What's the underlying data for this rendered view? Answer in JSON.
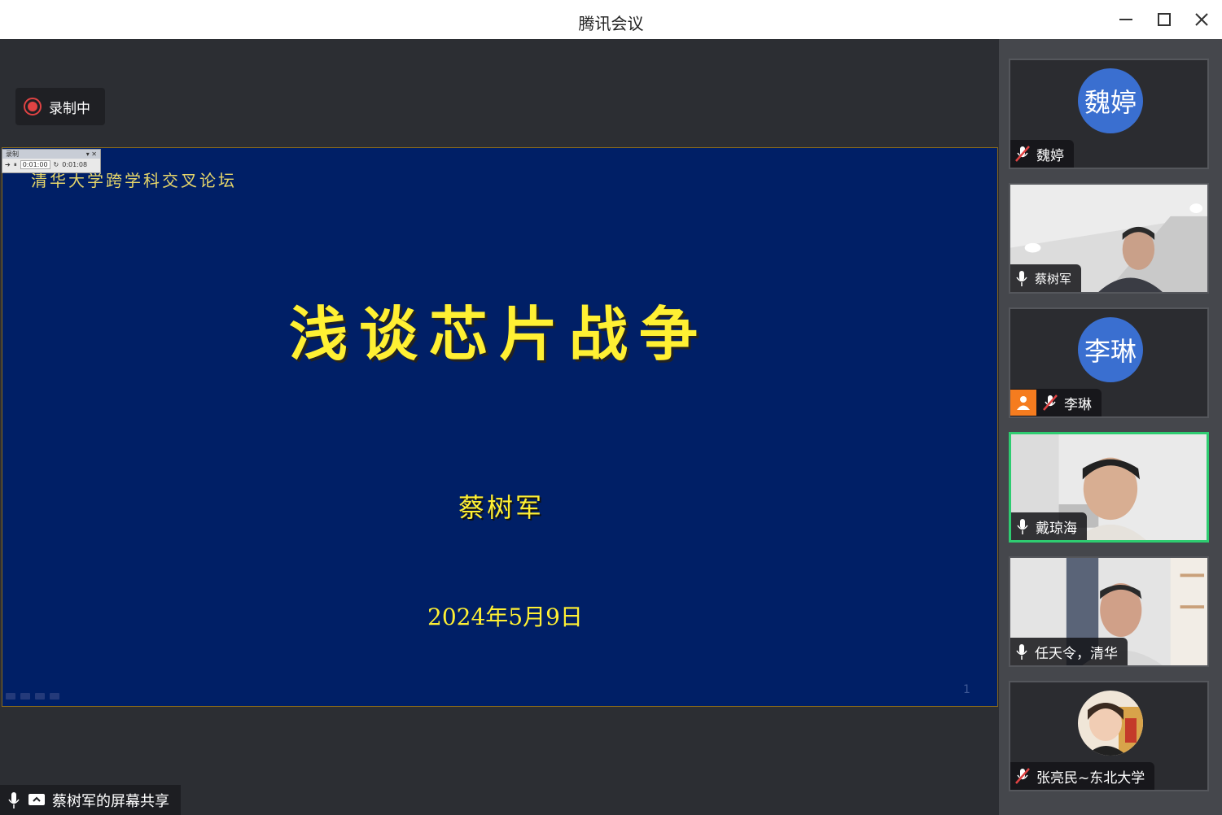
{
  "window": {
    "title": "腾讯会议"
  },
  "recording": {
    "label": "录制中"
  },
  "ppt_toolbar": {
    "title": "录制",
    "elapsed": "0:01:00",
    "total": "0:01:08"
  },
  "slide": {
    "forum": "清华大学跨学科交叉论坛",
    "title": "浅谈芯片战争",
    "speaker": "蔡树军",
    "date": "2024年5月9日",
    "page": "1"
  },
  "share": {
    "label": "蔡树军的屏幕共享"
  },
  "participants": [
    {
      "name": "魏婷",
      "avatar_text": "魏婷",
      "muted": true
    },
    {
      "name": "蔡树军",
      "muted": false
    },
    {
      "name": "李琳",
      "avatar_text": "李琳",
      "muted": true,
      "host": true
    },
    {
      "name": "戴琼海",
      "muted": false,
      "speaking": true
    },
    {
      "name": "任天令，清华",
      "muted": false
    },
    {
      "name": "张亮民~东北大学",
      "muted": true
    }
  ],
  "colors": {
    "avatar_blue": "#3a6fd0",
    "speaking_border": "#2ecc71",
    "slide_bg": "#001f66",
    "slide_text": "#fff033",
    "recording_red": "#e04343"
  }
}
